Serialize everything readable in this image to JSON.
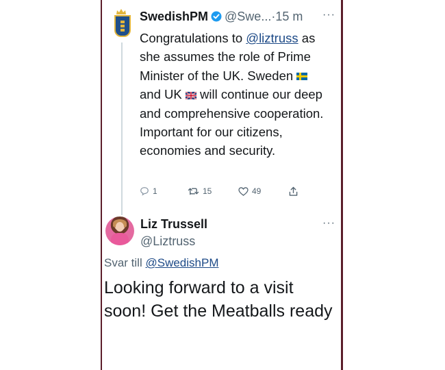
{
  "first_tweet": {
    "author_name": "SwedishPM",
    "handle": "@Swe...",
    "separator": "·",
    "time": "15 m",
    "more": "···",
    "text_part1": "Congratulations to ",
    "mention": "@liztruss",
    "text_part2": " as she assumes the role of Prime Minister of the UK. Sweden ",
    "text_part3": " and UK ",
    "text_part4": " will continue our deep and comprehensive cooperation. Important for our citizens, economies and security.",
    "actions": {
      "replies": "1",
      "retweets": "15",
      "likes": "49"
    }
  },
  "reply_tweet": {
    "author_name": "Liz Trussell",
    "handle": "@Liztruss",
    "more": "···",
    "reply_prefix": "Svar till ",
    "reply_to": "@SwedishPM",
    "text": "Looking forward to a visit soon! Get the Meatballs ready"
  },
  "colors": {
    "link": "#1d4a87",
    "muted": "#536471",
    "frame": "#5b1d2a",
    "verified": "#1d9bf0"
  }
}
